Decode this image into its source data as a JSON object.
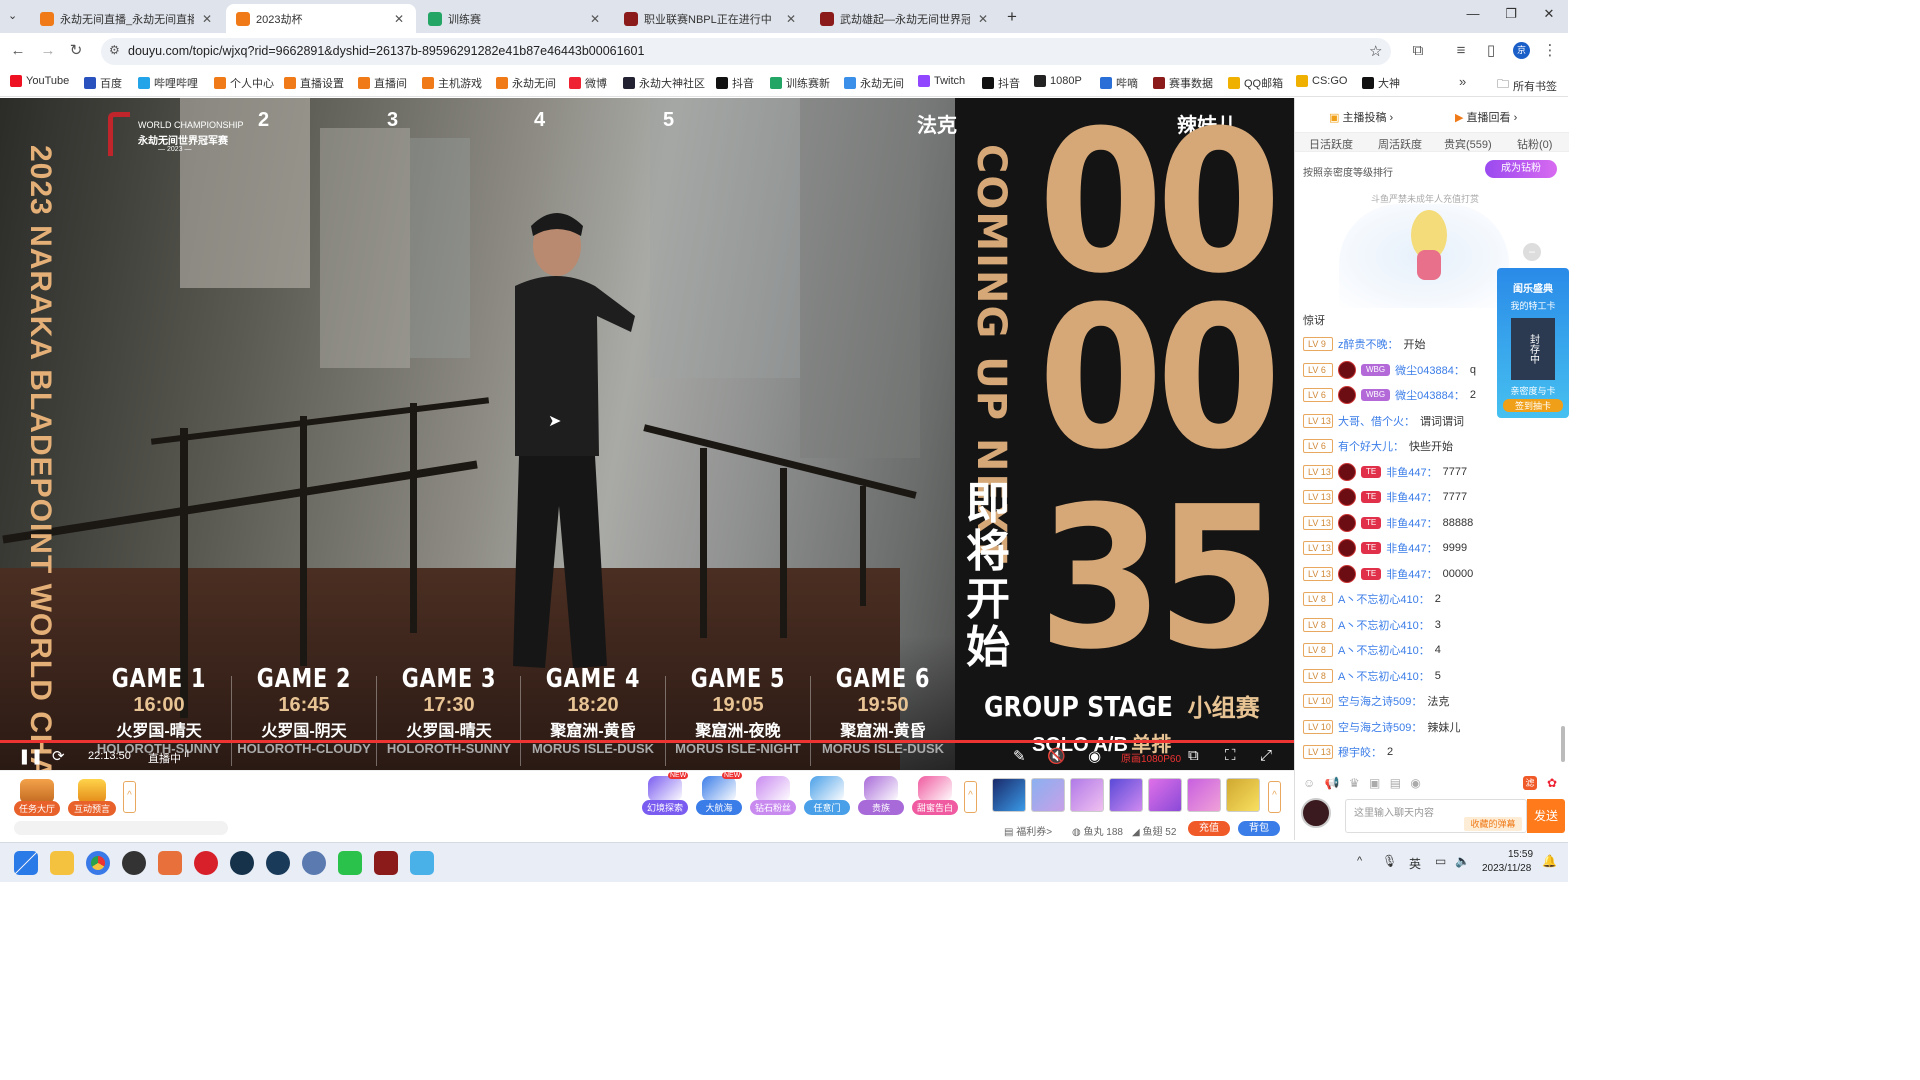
{
  "browser": {
    "tabs": [
      {
        "title": "永劫无间直播_永劫无间直播解",
        "favicon_color": "#f07a18",
        "active": false
      },
      {
        "title": "2023劫杯",
        "favicon_color": "#f07a18",
        "active": true
      },
      {
        "title": "训练赛",
        "favicon_color": "#23a566",
        "active": false
      },
      {
        "title": "职业联赛NBPL正在进行中",
        "favicon_color": "#8b1a1a",
        "active": false
      },
      {
        "title": "武劫雄起—永劫无间世界冠军",
        "favicon_color": "#8b1a1a",
        "active": false
      }
    ],
    "url": "douyu.com/topic/wjxq?rid=9662891&dyshid=26137b-89596291282e41b87e46443b00061601",
    "bookmarks": [
      {
        "label": "YouTube",
        "color": "#e12"
      },
      {
        "label": "百度",
        "color": "#2a52be"
      },
      {
        "label": "哔哩哔哩",
        "color": "#23a4e8"
      },
      {
        "label": "个人中心",
        "color": "#f07a18"
      },
      {
        "label": "直播设置",
        "color": "#f07a18"
      },
      {
        "label": "直播间",
        "color": "#f07a18"
      },
      {
        "label": "主机游戏",
        "color": "#f07a18"
      },
      {
        "label": "永劫无间",
        "color": "#f07a18"
      },
      {
        "label": "微博",
        "color": "#e23"
      },
      {
        "label": "永劫大神社区",
        "color": "#223"
      },
      {
        "label": "抖音",
        "color": "#111"
      },
      {
        "label": "训练赛新",
        "color": "#23a566"
      },
      {
        "label": "永劫无间",
        "color": "#3b8fe8"
      },
      {
        "label": "Twitch",
        "color": "#9146ff"
      },
      {
        "label": "抖音",
        "color": "#111"
      },
      {
        "label": "1080P",
        "color": "#222"
      },
      {
        "label": "哔嘀",
        "color": "#2a6fd8"
      },
      {
        "label": "赛事数据",
        "color": "#8b1a1a"
      },
      {
        "label": "QQ邮箱",
        "color": "#f0b000"
      },
      {
        "label": "CS:GO",
        "color": "#f0b000"
      },
      {
        "label": "大神",
        "color": "#111"
      }
    ],
    "all_bookmarks": "所有书签"
  },
  "video": {
    "logo_line1": "WORLD CHAMPIONSHIP",
    "logo_line2": "永劫无间世界冠军赛",
    "logo_line3": "— 2023 —",
    "side_title": "2023 NARAKA BLADEPOINT WORLD CHAMPIONSHI",
    "top_numbers": [
      "2",
      "3",
      "4",
      "5"
    ],
    "top_team_1": "法克",
    "top_team_2": "辣妹儿",
    "coming_up": "COMING UP NEXT",
    "coming_up_cn": "即将开始",
    "countdown": [
      "00",
      "00",
      "35"
    ],
    "group_stage": "GROUP STAGE",
    "group_stage_cn": "小组赛",
    "solo": "SOLO A/B",
    "solo_cn": "单排",
    "games": [
      {
        "name": "GAME 1",
        "time": "16:00",
        "map": "火罗国-晴天",
        "en": "HOLOROTH-SUNNY"
      },
      {
        "name": "GAME 2",
        "time": "16:45",
        "map": "火罗国-阴天",
        "en": "HOLOROTH-CLOUDY"
      },
      {
        "name": "GAME 3",
        "time": "17:30",
        "map": "火罗国-晴天",
        "en": "HOLOROTH-SUNNY"
      },
      {
        "name": "GAME 4",
        "time": "18:20",
        "map": "聚窟洲-黄昏",
        "en": "MORUS ISLE-DUSK"
      },
      {
        "name": "GAME 5",
        "time": "19:05",
        "map": "聚窟洲-夜晚",
        "en": "MORUS ISLE-NIGHT"
      },
      {
        "name": "GAME 6",
        "time": "19:50",
        "map": "聚窟洲-黄昏",
        "en": "MORUS ISLE-DUSK"
      }
    ],
    "controls": {
      "elapsed": "22:13:50",
      "live_label": "直播中",
      "quality": "原画1080P60"
    }
  },
  "below_video": {
    "task_hall": "任务大厅",
    "interactive": "互动预言",
    "gifts": [
      {
        "label": "幻境探索",
        "badge": "NEW",
        "color": "#7a5cf0"
      },
      {
        "label": "大航海",
        "badge": "NEW",
        "color": "#3b7de8"
      },
      {
        "label": "钻石粉丝",
        "badge": "",
        "color": "#c98af0"
      },
      {
        "label": "任意门",
        "badge": "",
        "color": "#4aa0e8"
      },
      {
        "label": "贵族",
        "badge": "",
        "color": "#a86ad8"
      },
      {
        "label": "甜蜜告白",
        "badge": "",
        "color": "#f05aa0"
      }
    ],
    "welfare": "福利券>",
    "fish_balls": "鱼丸 188",
    "fish_fins": "鱼翅 52",
    "recharge": "充值",
    "backpack": "背包"
  },
  "sidebar": {
    "anchor_vote": "主播投稿",
    "replay": "直播回看",
    "tabs": [
      "日活跃度",
      "周活跃度",
      "贵宾(559)",
      "钻粉(0)"
    ],
    "rank_note": "按照亲密度等级排行",
    "become_fan": "成为钻粉",
    "minor_notice": "斗鱼严禁未成年人充值打赏",
    "banner_top": "闺乐盛典",
    "banner_mid": "我的特工卡",
    "banner_seal": "封存中",
    "banner_bottom": "亲密度与卡",
    "banner_sign": "签到抽卡",
    "system_msg": "惊讶",
    "chat": [
      {
        "lv": "LV 9",
        "nick": "z醉贵不晚：",
        "msg": "开始",
        "badge": "",
        "badge_color": ""
      },
      {
        "lv": "LV 6",
        "nick": "微尘043884：",
        "msg": "q",
        "badge": "WBG",
        "badge_color": "#b36ad8"
      },
      {
        "lv": "LV 6",
        "nick": "微尘043884：",
        "msg": "2",
        "badge": "WBG",
        "badge_color": "#b36ad8"
      },
      {
        "lv": "LV 13",
        "nick": "大哥、借个火：",
        "msg": "谓词谓词",
        "badge": "",
        "badge_color": ""
      },
      {
        "lv": "LV 6",
        "nick": "有个好大儿：",
        "msg": "快些开始",
        "badge": "",
        "badge_color": ""
      },
      {
        "lv": "LV 13",
        "nick": "非鱼447：",
        "msg": "7777",
        "badge": "TE",
        "badge_color": "#e0304a"
      },
      {
        "lv": "LV 13",
        "nick": "非鱼447：",
        "msg": "7777",
        "badge": "TE",
        "badge_color": "#e0304a"
      },
      {
        "lv": "LV 13",
        "nick": "非鱼447：",
        "msg": "88888",
        "badge": "TE",
        "badge_color": "#e0304a"
      },
      {
        "lv": "LV 13",
        "nick": "非鱼447：",
        "msg": "9999",
        "badge": "TE",
        "badge_color": "#e0304a"
      },
      {
        "lv": "LV 13",
        "nick": "非鱼447：",
        "msg": "00000",
        "badge": "TE",
        "badge_color": "#e0304a"
      },
      {
        "lv": "LV 8",
        "nick": "A丶不忘初心410：",
        "msg": "2",
        "badge": "",
        "badge_color": ""
      },
      {
        "lv": "LV 8",
        "nick": "A丶不忘初心410：",
        "msg": "3",
        "badge": "",
        "badge_color": ""
      },
      {
        "lv": "LV 8",
        "nick": "A丶不忘初心410：",
        "msg": "4",
        "badge": "",
        "badge_color": ""
      },
      {
        "lv": "LV 8",
        "nick": "A丶不忘初心410：",
        "msg": "5",
        "badge": "",
        "badge_color": ""
      },
      {
        "lv": "LV 10",
        "nick": "空与海之诗509：",
        "msg": "法克",
        "badge": "",
        "badge_color": ""
      },
      {
        "lv": "LV 10",
        "nick": "空与海之诗509：",
        "msg": "辣妹儿",
        "badge": "",
        "badge_color": ""
      },
      {
        "lv": "LV 13",
        "nick": "穆宇皎：",
        "msg": "2",
        "badge": "",
        "badge_color": ""
      }
    ],
    "input_placeholder": "这里输入聊天内容",
    "barrage_button": "收藏的弹幕",
    "send": "发送"
  },
  "taskbar": {
    "ime": "英",
    "time": "15:59",
    "date": "2023/11/28"
  }
}
